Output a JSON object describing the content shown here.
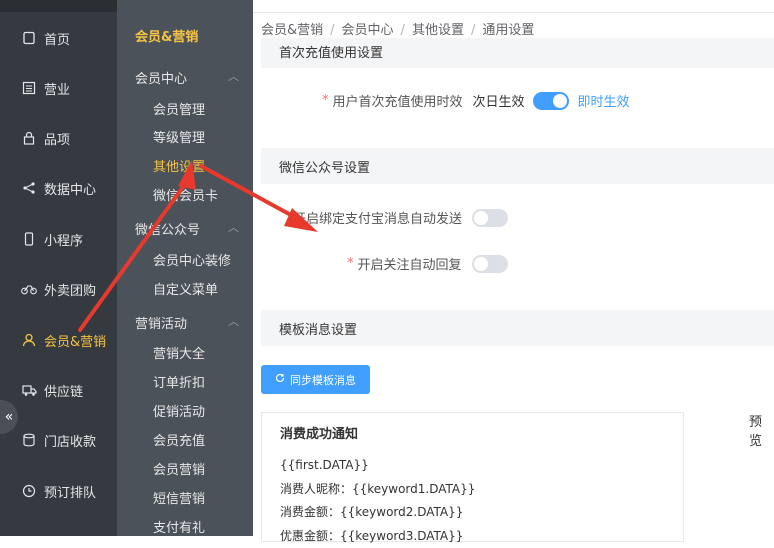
{
  "nav1": [
    {
      "label": "首页",
      "icon": "home-icon"
    },
    {
      "label": "营业",
      "icon": "calculator-icon"
    },
    {
      "label": "品项",
      "icon": "lock-icon"
    },
    {
      "label": "数据中心",
      "icon": "share-icon"
    },
    {
      "label": "小程序",
      "icon": "phone-icon"
    },
    {
      "label": "外卖团购",
      "icon": "bicycle-icon"
    },
    {
      "label": "会员&营销",
      "icon": "user-icon"
    },
    {
      "label": "供应链",
      "icon": "truck-icon"
    },
    {
      "label": "门店收款",
      "icon": "database-icon"
    },
    {
      "label": "预订排队",
      "icon": "clock-icon"
    }
  ],
  "collapse": "«",
  "sidebar2": {
    "title": "会员&营销",
    "groups": [
      {
        "label": "会员中心",
        "items": [
          "会员管理",
          "等级管理",
          "其他设置",
          "微信会员卡"
        ]
      },
      {
        "label": "微信公众号",
        "items": [
          "会员中心装修",
          "自定义菜单"
        ]
      },
      {
        "label": "营销活动",
        "items": [
          "营销大全",
          "订单折扣",
          "促销活动",
          "会员充值",
          "会员营销",
          "短信营销",
          "支付有礼"
        ]
      }
    ]
  },
  "breadcrumb": [
    "会员&营销",
    "会员中心",
    "其他设置",
    "通用设置"
  ],
  "sections": {
    "first_recharge": "首次充值使用设置",
    "wechat": "微信公众号设置",
    "template": "模板消息设置"
  },
  "first_recharge_row": {
    "label": "用户首次充值使用时效",
    "opt_left": "次日生效",
    "opt_right": "即时生效"
  },
  "alipay_row": {
    "label": "开启绑定支付宝消息自动发送"
  },
  "follow_row": {
    "label": "开启关注自动回复"
  },
  "sync_button": "同步模板消息",
  "card": {
    "title": "消费成功通知",
    "lines": [
      "{{first.DATA}}",
      "消费人昵称：{{keyword1.DATA}}",
      "消费金额：{{keyword2.DATA}}",
      "优惠金额：{{keyword3.DATA}}"
    ]
  },
  "preview": "预览",
  "colors": {
    "accent": "#409eff",
    "active": "#f5c242",
    "arrow": "#e8392d"
  }
}
